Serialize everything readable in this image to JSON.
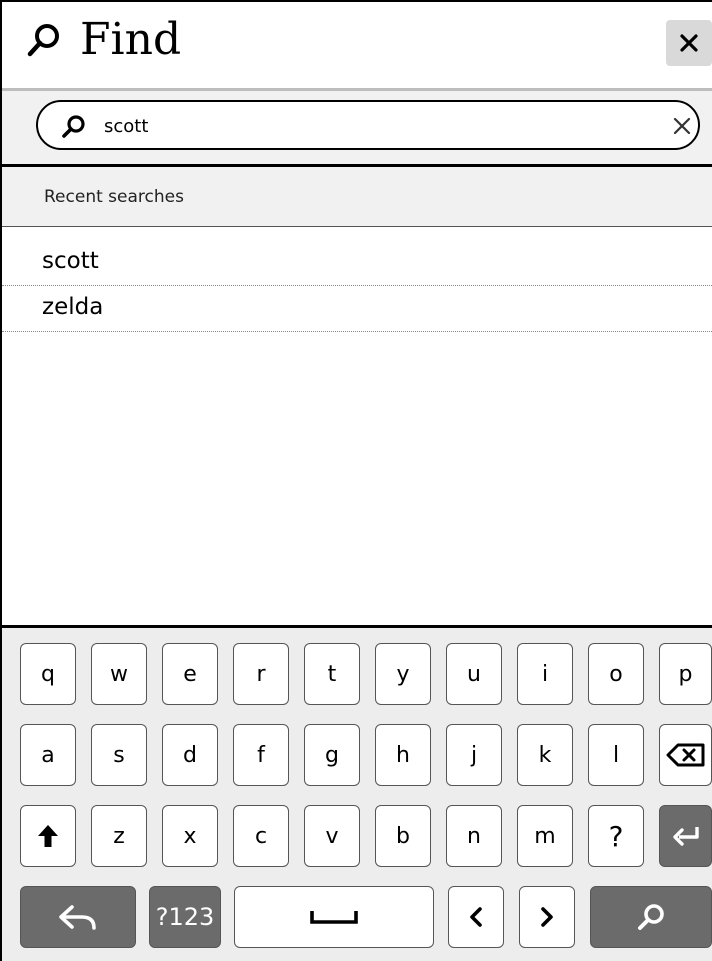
{
  "header": {
    "title": "Find"
  },
  "search": {
    "value": "scott",
    "placeholder": ""
  },
  "recent": {
    "label": "Recent searches",
    "items": [
      "scott",
      "zelda"
    ]
  },
  "keyboard": {
    "row1": [
      "q",
      "w",
      "e",
      "r",
      "t",
      "y",
      "u",
      "i",
      "o",
      "p"
    ],
    "row2": [
      "a",
      "s",
      "d",
      "f",
      "g",
      "h",
      "j",
      "k",
      "l"
    ],
    "row3": [
      "z",
      "x",
      "c",
      "v",
      "b",
      "n",
      "m",
      "?"
    ],
    "symbols_label": "?123"
  },
  "icons": {
    "title": "search-icon",
    "close": "close-icon",
    "search": "search-icon",
    "clear": "clear-icon",
    "backspace": "backspace-icon",
    "shift": "shift-arrow-icon",
    "enter": "enter-icon",
    "back": "back-arrow-icon",
    "space": "space-bar-icon",
    "left": "chevron-left-icon",
    "right": "chevron-right-icon",
    "search_key": "search-icon"
  }
}
